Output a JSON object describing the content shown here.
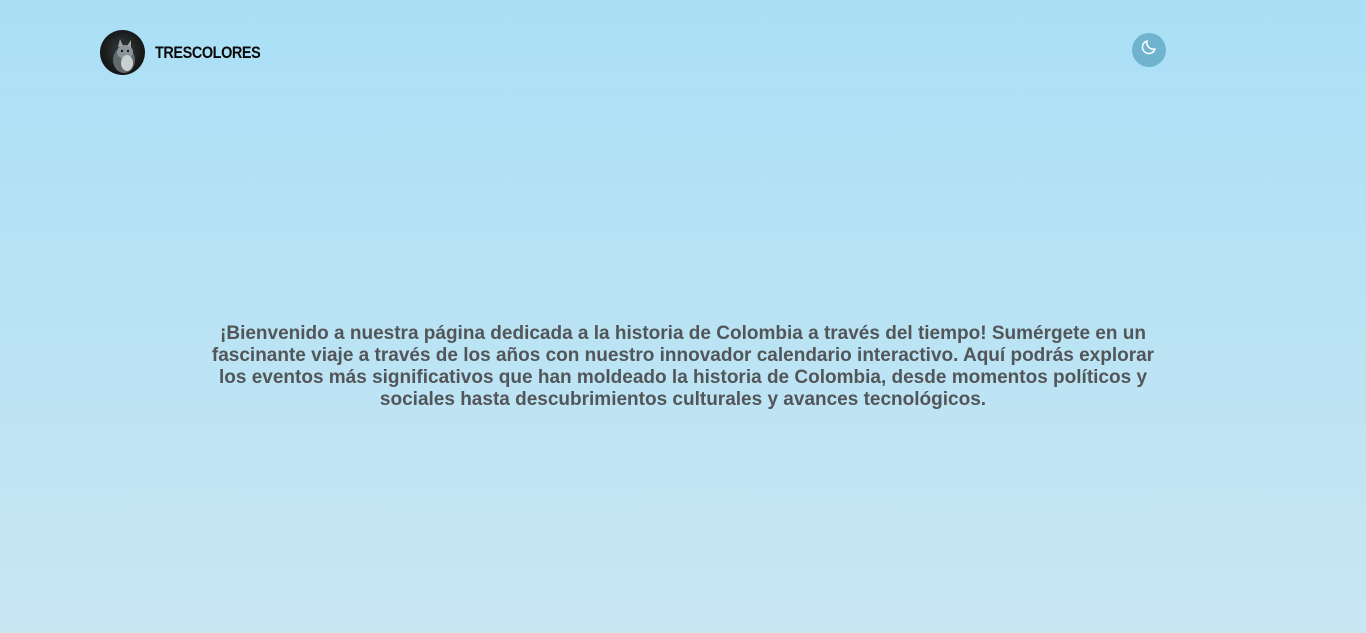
{
  "header": {
    "brand_name": "TRESCOLORES",
    "logo_icon": "cat-icon",
    "theme_toggle_icon": "moon-icon"
  },
  "main": {
    "intro_text": "¡Bienvenido a nuestra página dedicada a la historia de Colombia a través del tiempo! Sumérgete en un fascinante viaje a través de los años con nuestro innovador calendario interactivo. Aquí podrás explorar los eventos más significativos que han moldeado la historia de Colombia, desde momentos políticos y sociales hasta descubrimientos culturales y avances tecnológicos."
  },
  "colors": {
    "background_top": "#aadff6",
    "background_bottom": "#c9e6f3",
    "toggle_bg": "#6fb3cf",
    "text": "#525659"
  }
}
